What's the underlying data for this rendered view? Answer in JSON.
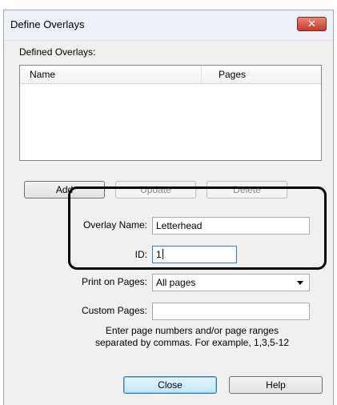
{
  "window": {
    "title": "Define Overlays",
    "close_glyph": "✕"
  },
  "defined_overlays": {
    "label": "Defined Overlays:",
    "columns": [
      "Name",
      "Pages"
    ],
    "rows": []
  },
  "buttons": {
    "add": "Add",
    "update": "Update",
    "delete": "Delete",
    "close": "Close",
    "help": "Help"
  },
  "form": {
    "overlay_name_label": "Overlay Name:",
    "overlay_name_value": "Letterhead",
    "id_label": "ID:",
    "id_value": "1",
    "print_on_pages_label": "Print on Pages:",
    "print_on_pages_value": "All pages",
    "custom_pages_label": "Custom Pages:",
    "custom_pages_value": "",
    "hint_line1": "Enter page numbers and/or page ranges",
    "hint_line2": "separated by commas. For example, 1,3,5-12"
  },
  "colors": {
    "highlight_border": "#000000",
    "close_button": "#c43b2b",
    "dialog_bg": "#f0f0f0"
  }
}
